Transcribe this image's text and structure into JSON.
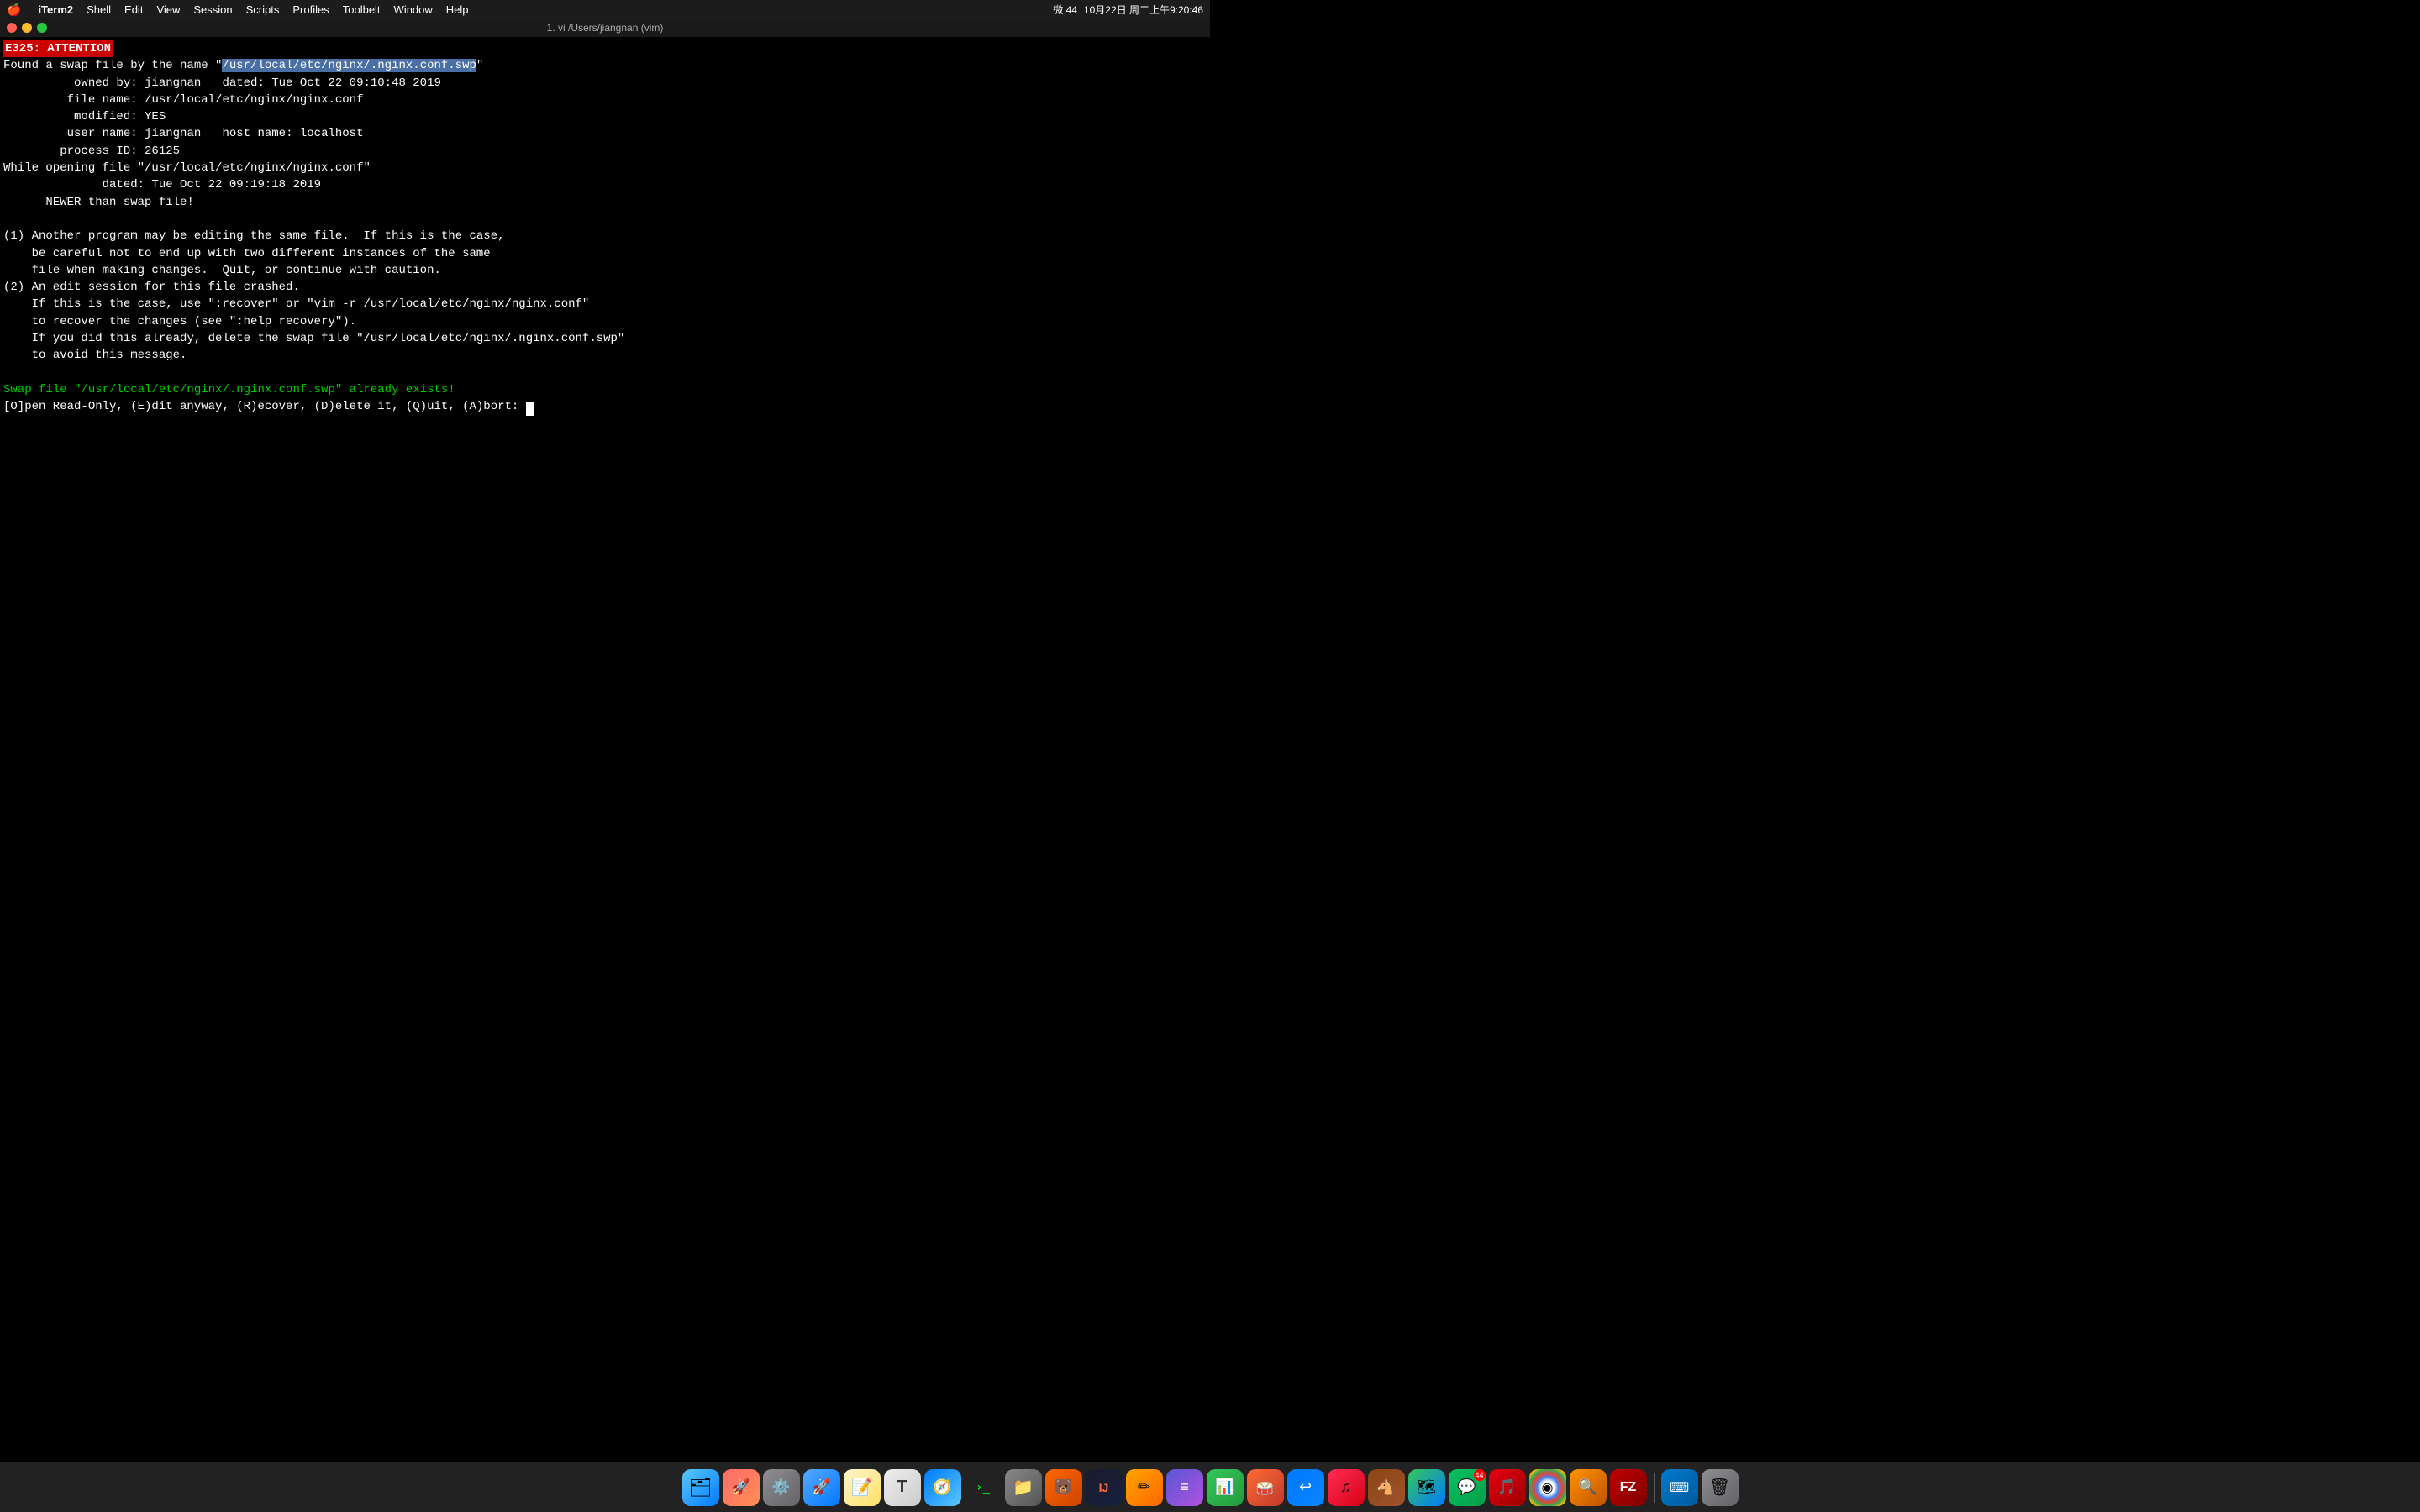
{
  "menubar": {
    "apple": "🍎",
    "app_name": "iTerm2",
    "menus": [
      "Shell",
      "Edit",
      "View",
      "Session",
      "Scripts",
      "Profiles",
      "Toolbelt",
      "Window",
      "Help"
    ],
    "right_items": {
      "wechat_icon": "微",
      "battery_wifi": "44",
      "time": "10月22日 周二上午9:20:46"
    }
  },
  "titlebar": {
    "title": "1. vi /Users/jiangnan (vim)"
  },
  "terminal": {
    "error_badge": "E325: ATTENTION",
    "lines": [
      "Found a swap file by the name \"/usr/local/etc/nginx/.nginx.conf.swp\"",
      "          owned by: jiangnan   dated: Tue Oct 22 09:10:48 2019",
      "         file name: /usr/local/etc/nginx/nginx.conf",
      "          modified: YES",
      "         user name: jiangnan   host name: localhost",
      "        process ID: 26125",
      "While opening file \"/usr/local/etc/nginx/nginx.conf\"",
      "              dated: Tue Oct 22 09:19:18 2019",
      "      NEWER than swap file!",
      "",
      "(1) Another program may be editing the same file.  If this is the case,",
      "    be careful not to end up with two different instances of the same",
      "    file when making changes.  Quit, or continue with caution.",
      "(2) An edit session for this file crashed.",
      "    If this is the case, use \":recover\" or \"vim -r /usr/local/etc/nginx/nginx.conf\"",
      "    to recover the changes (see \":help recovery\").",
      "    If you did this already, delete the swap file \"/usr/local/etc/nginx/.nginx.conf.swp\"",
      "    to avoid this message."
    ],
    "swap_exists_line": "Swap file \"/usr/local/etc/nginx/.nginx.conf.swp\" already exists!",
    "prompt_line": "[O]pen Read-Only, (E)dit anyway, (R)ecover, (D)elete it, (Q)uit, (A)bort: ",
    "highlighted_path": "/usr/local/etc/nginx/.nginx.conf.swp"
  },
  "dock": {
    "items": [
      {
        "name": "Finder",
        "emoji": "🗂",
        "class": "di-finder"
      },
      {
        "name": "Launchpad",
        "emoji": "🚀",
        "class": "di-launchpad"
      },
      {
        "name": "System Preferences",
        "emoji": "⚙️",
        "class": "di-syspref"
      },
      {
        "name": "Rocket",
        "emoji": "🚀",
        "class": "di-rocket"
      },
      {
        "name": "Notes",
        "emoji": "📝",
        "class": "di-notes"
      },
      {
        "name": "Typora",
        "emoji": "T",
        "class": "di-typora"
      },
      {
        "name": "Safari",
        "emoji": "🧭",
        "class": "di-safari"
      },
      {
        "name": "iTerm2",
        "emoji": ">_",
        "class": "di-iterm"
      },
      {
        "name": "Files",
        "emoji": "📁",
        "class": "di-files"
      },
      {
        "name": "Bear",
        "emoji": "🐻",
        "class": "di-bear"
      },
      {
        "name": "IntelliJ",
        "emoji": "I",
        "class": "di-intellij"
      },
      {
        "name": "Sketch",
        "emoji": "✏",
        "class": "di-sketch"
      },
      {
        "name": "Stack",
        "emoji": "≡",
        "class": "di-stack"
      },
      {
        "name": "Numbers",
        "emoji": "📊",
        "class": "di-numbers"
      },
      {
        "name": "Taiko",
        "emoji": "🥁",
        "class": "di-taiko"
      },
      {
        "name": "Back",
        "emoji": "↩",
        "class": "di-back"
      },
      {
        "name": "Music",
        "emoji": "♪",
        "class": "di-bear2"
      },
      {
        "name": "Horse",
        "emoji": "🐴",
        "class": "di-horse"
      },
      {
        "name": "Maps",
        "emoji": "🗺",
        "class": "di-maps"
      },
      {
        "name": "WeChat",
        "emoji": "💬",
        "class": "di-wechat",
        "badge": "44"
      },
      {
        "name": "NetEase",
        "emoji": "🎵",
        "class": "di-netease"
      },
      {
        "name": "Chrome",
        "emoji": "◉",
        "class": "di-chrome"
      },
      {
        "name": "Search",
        "emoji": "🔍",
        "class": "di-search"
      },
      {
        "name": "FileZilla",
        "emoji": "Z",
        "class": "di-filezilla"
      },
      {
        "name": "VSCode",
        "emoji": "⌨",
        "class": "di-vscode"
      },
      {
        "name": "Trash",
        "emoji": "🗑",
        "class": "di-trash"
      }
    ]
  }
}
